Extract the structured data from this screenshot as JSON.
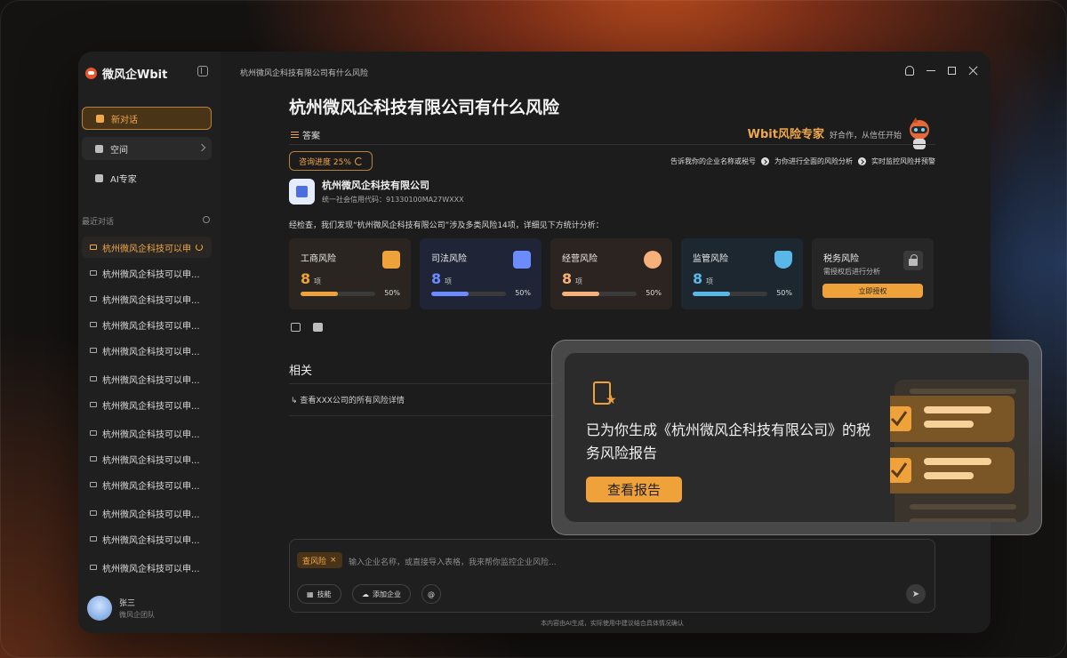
{
  "app": {
    "name": "微风企Wbit",
    "window_title": "杭州微风企科技有限公司有什么风险"
  },
  "sidebar": {
    "new_chat": "新对话",
    "space": "空间",
    "ai_expert": "AI专家",
    "recent_title": "最近对话",
    "history": [
      "杭州微风企科技可以申",
      "杭州微风企科技可以申...",
      "杭州微风企科技可以申...",
      "杭州微风企科技可以申...",
      "杭州微风企科技可以申...",
      "杭州微风企科技可以申...",
      "杭州微风企科技可以申...",
      "杭州微风企科技可以申...",
      "杭州微风企科技可以申...",
      "杭州微风企科技可以申...",
      "杭州微风企科技可以申...",
      "杭州微风企科技可以申...",
      "杭州微风企科技可以申..."
    ],
    "user": {
      "name": "张三",
      "team": "微风企团队"
    }
  },
  "main": {
    "question": "杭州微风企科技有限公司有什么风险",
    "answer_tab": "答案",
    "expert_title": "Wbit风险专家",
    "expert_sub": "好合作，从信任开始",
    "progress_label": "咨询进度 25%",
    "steps": [
      "告诉我你的企业名称或税号",
      "为你进行全面的风险分析",
      "实时监控风险并预警"
    ],
    "company": {
      "name": "杭州微风企科技有限公司",
      "code": "统一社会信用代码：91330100MA27WXXX"
    },
    "summary": "经检查，我们发现“杭州微风企科技有限公司”涉及多类风险14项，详细见下方统计分析：",
    "cards": [
      {
        "title": "工商风险",
        "count": "8",
        "unit": "项",
        "pct": "50%",
        "progress": 0.5,
        "color": "#f0a23a",
        "bg": "#2a2520"
      },
      {
        "title": "司法风险",
        "count": "8",
        "unit": "项",
        "pct": "50%",
        "progress": 0.5,
        "color": "#6b8cff",
        "bg": "#1f2436"
      },
      {
        "title": "经营风险",
        "count": "8",
        "unit": "项",
        "pct": "50%",
        "progress": 0.5,
        "color": "#f6b07a",
        "bg": "#2c2420"
      },
      {
        "title": "监管风险",
        "count": "8",
        "unit": "项",
        "pct": "50%",
        "progress": 0.5,
        "color": "#5ab8e8",
        "bg": "#1c2730"
      }
    ],
    "tax_card": {
      "title": "税务风险",
      "sub": "需授权后进行分析",
      "button": "立即授权"
    },
    "related_title": "相关",
    "related_link": "查看XXX公司的所有风险详情"
  },
  "input": {
    "chip": "查风险",
    "placeholder": "输入企业名称，或直接导入表格，我来帮你监控企业风险...",
    "tools": [
      "技能",
      "添加企业",
      "@"
    ],
    "disclaimer": "本内容由AI生成，实际使用中建议结合具体情况确认"
  },
  "popup": {
    "text": "已为你生成《杭州微风企科技有限公司》的税务风险报告",
    "button": "查看报告"
  }
}
